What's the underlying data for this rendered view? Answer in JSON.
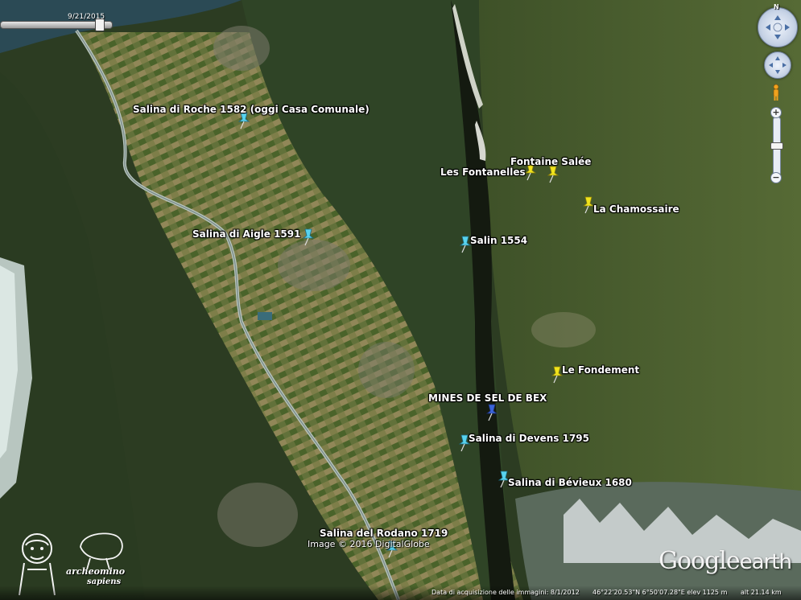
{
  "timeline": {
    "date": "9/21/2015"
  },
  "labels": {
    "roche": "Salina di Roche 1582 (oggi Casa Comunale)",
    "aigle": "Salina di Aigle 1591",
    "fontanelles": "Les Fontanelles",
    "fontaine": "Fontaine Salée",
    "chamossaire": "La Chamossaire",
    "salin": "Salin 1554",
    "fondement": "Le Fondement",
    "mines": "MINES DE SEL DE BEX",
    "devens": "Salina di Devens 1795",
    "bevieux": "Salina di Bévieux 1680",
    "rodano": "Salina del Rodano 1719"
  },
  "credit": "Image © 2016 DigitalGlobe",
  "logo": {
    "google": "Google",
    "earth": "earth"
  },
  "status": {
    "acquisition": "Data di acquisizione delle immagini: 8/1/2012",
    "coords": "46°22'20.53\"N    6°50'07.28\"E  elev  1125 m",
    "eye": "alt  21.14 km"
  },
  "nav": {
    "north": "N",
    "zoom_in": "+",
    "zoom_out": "−"
  },
  "watermark": {
    "line1": "archeomino",
    "line2": "sapiens"
  },
  "pin_colors": {
    "cyan": "#58d3ee",
    "yellow": "#f1e41c",
    "blue": "#3a63d8"
  }
}
